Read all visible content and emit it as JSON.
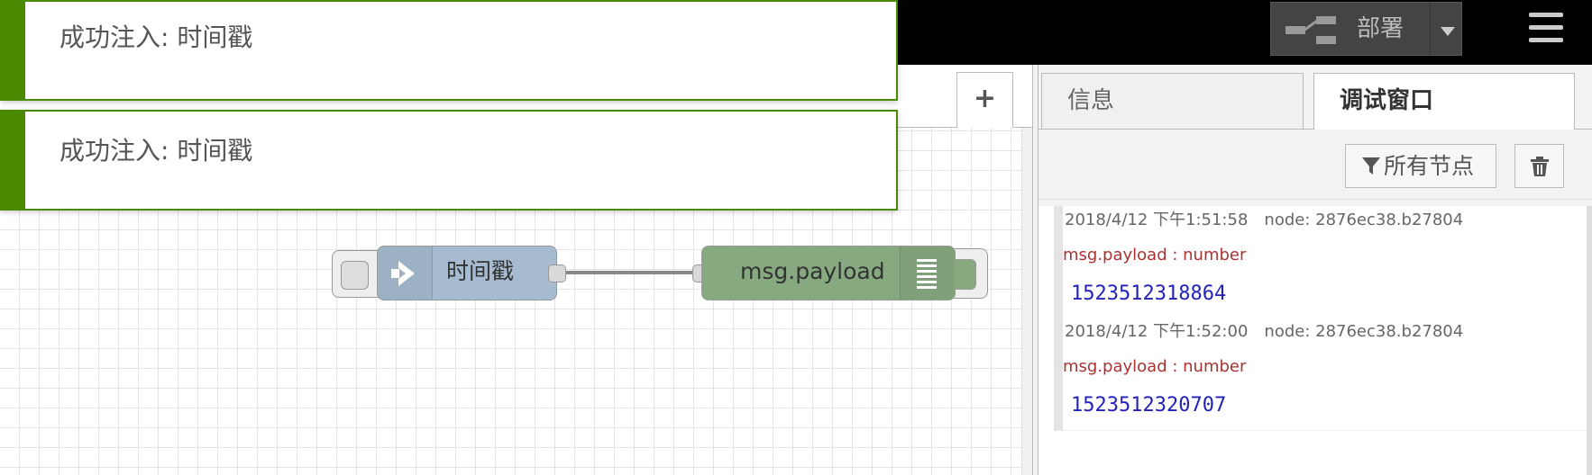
{
  "header": {
    "deploy_label": "部署",
    "deploy_icon": "deploy-icon",
    "menu_icon": "hamburger-menu-icon"
  },
  "workspace": {
    "add_tab_label": "+"
  },
  "flow": {
    "inject_node": {
      "label": "时间戳",
      "icon": "inject-arrow-icon",
      "color": "#a6bbcf"
    },
    "debug_node": {
      "label": "msg.payload",
      "icon": "debug-list-icon",
      "color": "#87a980"
    }
  },
  "notifications": [
    {
      "text": "成功注入: 时间戳"
    },
    {
      "text": "成功注入: 时间戳"
    }
  ],
  "sidebar": {
    "tabs": [
      {
        "label": "信息",
        "active": false
      },
      {
        "label": "调试窗口",
        "active": true
      }
    ],
    "filter_label": "所有节点",
    "clear_icon": "trash-icon",
    "messages": [
      {
        "timestamp": "2018/4/12 下午1:51:58",
        "node": "node: 2876ec38.b27804",
        "topic": "msg.payload : number",
        "value": "1523512318864"
      },
      {
        "timestamp": "2018/4/12 下午1:52:00",
        "node": "node: 2876ec38.b27804",
        "topic": "msg.payload : number",
        "value": "1523512320707"
      }
    ]
  },
  "colors": {
    "header_bg": "#000000",
    "notification_accent": "#4b8a00",
    "topic_color": "#aa3333",
    "value_color": "#2222bb"
  }
}
